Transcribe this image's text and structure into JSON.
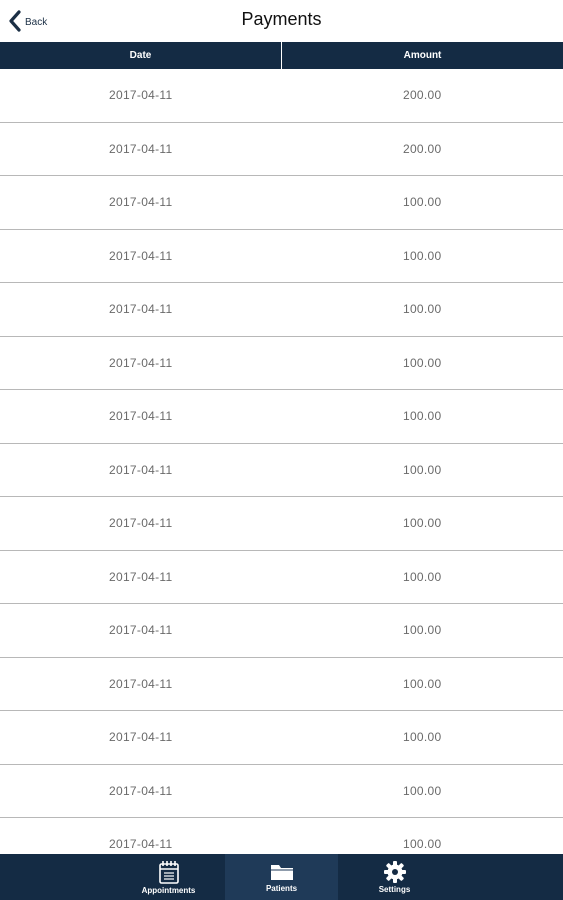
{
  "header": {
    "back_label": "Back",
    "title": "Payments"
  },
  "table": {
    "columns": [
      "Date",
      "Amount"
    ],
    "rows": [
      {
        "date": "2017-04-11",
        "amount": "200.00"
      },
      {
        "date": "2017-04-11",
        "amount": "200.00"
      },
      {
        "date": "2017-04-11",
        "amount": "100.00"
      },
      {
        "date": "2017-04-11",
        "amount": "100.00"
      },
      {
        "date": "2017-04-11",
        "amount": "100.00"
      },
      {
        "date": "2017-04-11",
        "amount": "100.00"
      },
      {
        "date": "2017-04-11",
        "amount": "100.00"
      },
      {
        "date": "2017-04-11",
        "amount": "100.00"
      },
      {
        "date": "2017-04-11",
        "amount": "100.00"
      },
      {
        "date": "2017-04-11",
        "amount": "100.00"
      },
      {
        "date": "2017-04-11",
        "amount": "100.00"
      },
      {
        "date": "2017-04-11",
        "amount": "100.00"
      },
      {
        "date": "2017-04-11",
        "amount": "100.00"
      },
      {
        "date": "2017-04-11",
        "amount": "100.00"
      },
      {
        "date": "2017-04-11",
        "amount": "100.00"
      }
    ]
  },
  "bottom_nav": {
    "items": [
      {
        "label": "Appointments",
        "icon": "calendar-icon",
        "active": false
      },
      {
        "label": "Patients",
        "icon": "folder-icon",
        "active": true
      },
      {
        "label": "Settings",
        "icon": "gear-icon",
        "active": false
      }
    ]
  },
  "colors": {
    "navy": "#142b44",
    "active_tab": "#1f3a58",
    "row_text": "#6a6a6a",
    "divider": "#b8b8b8"
  }
}
